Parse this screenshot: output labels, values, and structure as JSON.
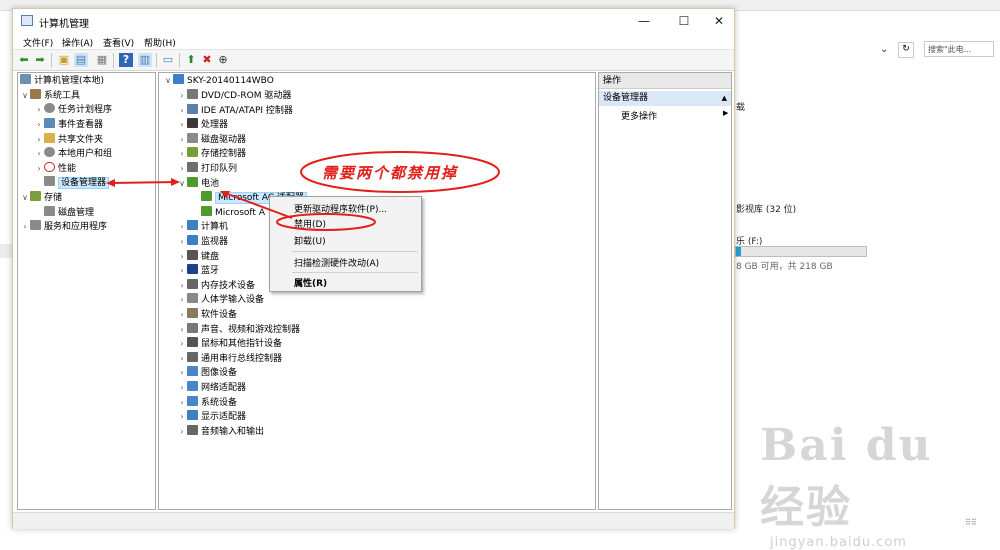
{
  "background": {
    "search_placeholder": "搜索\"此电...",
    "text_1": "载",
    "text_2": "影视库 (32 位)",
    "text_3": "乐 (F:)",
    "text_4": "8 GB 可用，共 218 GB",
    "storage_fraction": 0.04,
    "watermark_main": "Bai du 经验",
    "watermark_sub": "jingyan.baidu.com"
  },
  "window": {
    "title": "计算机管理",
    "minimize": "—",
    "maximize": "☐",
    "close": "✕"
  },
  "menu": [
    "文件(F)",
    "操作(A)",
    "查看(V)",
    "帮助(H)"
  ],
  "left_tree": [
    {
      "label": "计算机管理(本地)",
      "level": 0,
      "arrow": ""
    },
    {
      "label": "系统工具",
      "level": 1,
      "arrow": "∨"
    },
    {
      "label": "任务计划程序",
      "level": 2,
      "arrow": "›"
    },
    {
      "label": "事件查看器",
      "level": 2,
      "arrow": "›"
    },
    {
      "label": "共享文件夹",
      "level": 2,
      "arrow": "›"
    },
    {
      "label": "本地用户和组",
      "level": 2,
      "arrow": "›"
    },
    {
      "label": "性能",
      "level": 2,
      "arrow": "›"
    },
    {
      "label": "设备管理器",
      "level": 2,
      "arrow": ""
    },
    {
      "label": "存储",
      "level": 1,
      "arrow": "∨"
    },
    {
      "label": "磁盘管理",
      "level": 2,
      "arrow": ""
    },
    {
      "label": "服务和应用程序",
      "level": 1,
      "arrow": "›"
    }
  ],
  "device_tree": {
    "root": "SKY-20140114WBO",
    "items": [
      {
        "label": "DVD/CD-ROM 驱动器",
        "color": "#777777"
      },
      {
        "label": "IDE ATA/ATAPI 控制器",
        "color": "#5b7fa6"
      },
      {
        "label": "处理器",
        "color": "#3a3a3a"
      },
      {
        "label": "磁盘驱动器",
        "color": "#8a8a8a"
      },
      {
        "label": "存储控制器",
        "color": "#7a9e3a"
      },
      {
        "label": "打印队列",
        "color": "#6d6d6d"
      },
      {
        "label": "电池",
        "color": "#4f9a2f",
        "expanded": true
      },
      {
        "label": "计算机",
        "color": "#3d7fc4"
      },
      {
        "label": "监视器",
        "color": "#3d7fc4"
      },
      {
        "label": "键盘",
        "color": "#555555"
      },
      {
        "label": "蓝牙",
        "color": "#1e3f8a"
      },
      {
        "label": "内存技术设备",
        "color": "#666666"
      },
      {
        "label": "人体学输入设备",
        "color": "#888888"
      },
      {
        "label": "软件设备",
        "color": "#8a7a5a"
      },
      {
        "label": "声音、视频和游戏控制器",
        "color": "#777777"
      },
      {
        "label": "鼠标和其他指针设备",
        "color": "#555555"
      },
      {
        "label": "通用串行总线控制器",
        "color": "#666666"
      },
      {
        "label": "图像设备",
        "color": "#4a86c5"
      },
      {
        "label": "网络适配器",
        "color": "#4a86c5"
      },
      {
        "label": "系统设备",
        "color": "#4a86c5"
      },
      {
        "label": "显示适配器",
        "color": "#3d7fc4"
      },
      {
        "label": "音频输入和输出",
        "color": "#666666"
      }
    ],
    "battery_children": [
      "Microsoft AC 适配器",
      "Microsoft A"
    ]
  },
  "actions": {
    "header": "操作",
    "section": "设备管理器",
    "more": "更多操作"
  },
  "context_menu": {
    "update": "更新驱动程序软件(P)...",
    "disable": "禁用(D)",
    "uninstall": "卸载(U)",
    "scan": "扫描检测硬件改动(A)",
    "properties": "属性(R)"
  },
  "annotation": "需要两个都禁用掉",
  "colors": {
    "annotation": "#e0201b",
    "selection": "#cce8ff"
  }
}
